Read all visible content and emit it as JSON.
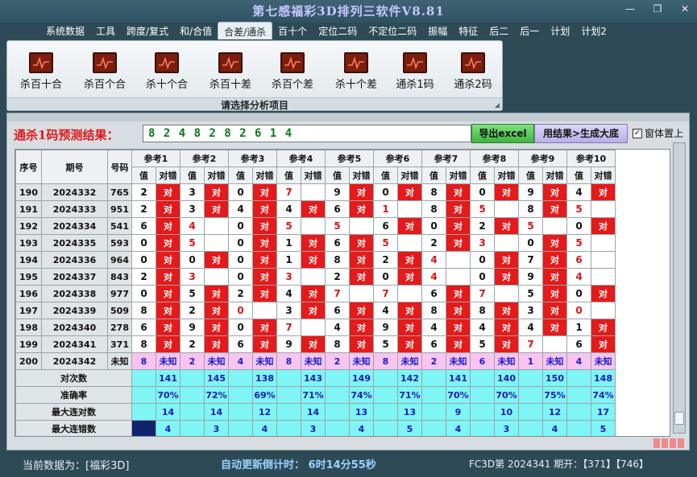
{
  "window": {
    "title": "第七感福彩3D排列三软件V8.81",
    "minimize_glyph": "—",
    "restore_glyph": "❐",
    "close_glyph": "✕"
  },
  "menu": [
    {
      "label": "系统数据",
      "active": false
    },
    {
      "label": "工具",
      "active": false
    },
    {
      "label": "跨度/复式",
      "active": false
    },
    {
      "label": "和/合值",
      "active": false
    },
    {
      "label": "合差/通杀",
      "active": true
    },
    {
      "label": "百十个",
      "active": false
    },
    {
      "label": "定位二码",
      "active": false
    },
    {
      "label": "不定位二码",
      "active": false
    },
    {
      "label": "振幅",
      "active": false
    },
    {
      "label": "特征",
      "active": false
    },
    {
      "label": "后二",
      "active": false
    },
    {
      "label": "后一",
      "active": false
    },
    {
      "label": "计划",
      "active": false
    },
    {
      "label": "计划2",
      "active": false
    }
  ],
  "ribbon": {
    "tools": [
      "杀百十合",
      "杀百个合",
      "杀十个合",
      "杀百十差",
      "杀百个差",
      "杀十个差",
      "通杀1码",
      "通杀2码"
    ],
    "caption": "请选择分析项目",
    "icon": "chart-icon"
  },
  "panel": {
    "result_label": "通杀1码预测结果：",
    "result_value": "8 2 4 8 2 8 2 6 1 4",
    "export_button": "导出excel",
    "generate_button": "用结果>生成大底",
    "on_top_label": "窗体置上",
    "on_top_checked": true
  },
  "table": {
    "headers": {
      "seq": "序号",
      "period": "期号",
      "number": "号码",
      "value": "值",
      "result": "对错"
    },
    "refs": [
      "参考1",
      "参考2",
      "参考3",
      "参考4",
      "参考5",
      "参考6",
      "参考7",
      "参考8",
      "参考9",
      "参考10"
    ],
    "hit_text": "对",
    "rows": [
      {
        "seq": "190",
        "period": "2024332",
        "number": "765",
        "cells": [
          [
            "2",
            "对",
            false
          ],
          [
            "3",
            "对",
            false
          ],
          [
            "0",
            "对",
            false
          ],
          [
            "7",
            "",
            true
          ],
          [
            "9",
            "对",
            false
          ],
          [
            "0",
            "对",
            false
          ],
          [
            "8",
            "对",
            false
          ],
          [
            "0",
            "对",
            false
          ],
          [
            "9",
            "对",
            false
          ],
          [
            "4",
            "对",
            false
          ]
        ]
      },
      {
        "seq": "191",
        "period": "2024333",
        "number": "951",
        "cells": [
          [
            "2",
            "对",
            false
          ],
          [
            "3",
            "对",
            false
          ],
          [
            "4",
            "对",
            false
          ],
          [
            "4",
            "对",
            false
          ],
          [
            "6",
            "对",
            false
          ],
          [
            "1",
            "",
            true
          ],
          [
            "8",
            "对",
            false
          ],
          [
            "5",
            "",
            true
          ],
          [
            "8",
            "对",
            false
          ],
          [
            "5",
            "",
            true
          ]
        ]
      },
      {
        "seq": "192",
        "period": "2024334",
        "number": "541",
        "cells": [
          [
            "6",
            "对",
            false
          ],
          [
            "4",
            "",
            true
          ],
          [
            "0",
            "对",
            false
          ],
          [
            "5",
            "",
            true
          ],
          [
            "5",
            "",
            true
          ],
          [
            "6",
            "对",
            false
          ],
          [
            "0",
            "对",
            false
          ],
          [
            "2",
            "对",
            false
          ],
          [
            "5",
            "",
            true
          ],
          [
            "0",
            "对",
            false
          ]
        ]
      },
      {
        "seq": "193",
        "period": "2024335",
        "number": "593",
        "cells": [
          [
            "0",
            "对",
            false
          ],
          [
            "5",
            "",
            true
          ],
          [
            "0",
            "对",
            false
          ],
          [
            "1",
            "对",
            false
          ],
          [
            "6",
            "对",
            false
          ],
          [
            "5",
            "",
            true
          ],
          [
            "2",
            "对",
            false
          ],
          [
            "3",
            "",
            true
          ],
          [
            "0",
            "对",
            false
          ],
          [
            "5",
            "",
            true
          ]
        ]
      },
      {
        "seq": "194",
        "period": "2024336",
        "number": "964",
        "cells": [
          [
            "0",
            "对",
            false
          ],
          [
            "0",
            "对",
            false
          ],
          [
            "0",
            "对",
            false
          ],
          [
            "1",
            "对",
            false
          ],
          [
            "8",
            "对",
            false
          ],
          [
            "2",
            "对",
            false
          ],
          [
            "4",
            "",
            true
          ],
          [
            "0",
            "对",
            false
          ],
          [
            "7",
            "对",
            false
          ],
          [
            "6",
            "",
            true
          ]
        ]
      },
      {
        "seq": "195",
        "period": "2024337",
        "number": "843",
        "cells": [
          [
            "2",
            "对",
            false
          ],
          [
            "3",
            "",
            true
          ],
          [
            "0",
            "对",
            false
          ],
          [
            "3",
            "",
            true
          ],
          [
            "2",
            "对",
            false
          ],
          [
            "0",
            "对",
            false
          ],
          [
            "4",
            "",
            true
          ],
          [
            "0",
            "对",
            false
          ],
          [
            "9",
            "对",
            false
          ],
          [
            "4",
            "",
            true
          ]
        ]
      },
      {
        "seq": "196",
        "period": "2024338",
        "number": "977",
        "cells": [
          [
            "0",
            "对",
            false
          ],
          [
            "5",
            "对",
            false
          ],
          [
            "2",
            "对",
            false
          ],
          [
            "4",
            "对",
            false
          ],
          [
            "7",
            "",
            true
          ],
          [
            "7",
            "",
            true
          ],
          [
            "6",
            "对",
            false
          ],
          [
            "7",
            "",
            true
          ],
          [
            "5",
            "对",
            false
          ],
          [
            "0",
            "对",
            false
          ]
        ]
      },
      {
        "seq": "197",
        "period": "2024339",
        "number": "509",
        "cells": [
          [
            "8",
            "对",
            false
          ],
          [
            "2",
            "对",
            false
          ],
          [
            "0",
            "",
            true
          ],
          [
            "3",
            "对",
            false
          ],
          [
            "6",
            "对",
            false
          ],
          [
            "4",
            "对",
            false
          ],
          [
            "8",
            "对",
            false
          ],
          [
            "8",
            "对",
            false
          ],
          [
            "3",
            "对",
            false
          ],
          [
            "0",
            "",
            true
          ]
        ]
      },
      {
        "seq": "198",
        "period": "2024340",
        "number": "278",
        "cells": [
          [
            "6",
            "对",
            false
          ],
          [
            "9",
            "对",
            false
          ],
          [
            "0",
            "对",
            false
          ],
          [
            "7",
            "",
            true
          ],
          [
            "4",
            "对",
            false
          ],
          [
            "9",
            "对",
            false
          ],
          [
            "4",
            "对",
            false
          ],
          [
            "4",
            "对",
            false
          ],
          [
            "4",
            "对",
            false
          ],
          [
            "1",
            "对",
            false
          ]
        ]
      },
      {
        "seq": "199",
        "period": "2024341",
        "number": "371",
        "cells": [
          [
            "8",
            "对",
            false
          ],
          [
            "2",
            "对",
            false
          ],
          [
            "6",
            "对",
            false
          ],
          [
            "9",
            "对",
            false
          ],
          [
            "8",
            "对",
            false
          ],
          [
            "5",
            "对",
            false
          ],
          [
            "6",
            "对",
            false
          ],
          [
            "5",
            "对",
            false
          ],
          [
            "7",
            "",
            true
          ],
          [
            "6",
            "对",
            false
          ]
        ]
      }
    ],
    "unknown_row": {
      "seq": "200",
      "period": "2024342",
      "number": "未知",
      "values": [
        "8",
        "2",
        "4",
        "8",
        "2",
        "8",
        "2",
        "6",
        "1",
        "4"
      ],
      "result": "未知"
    },
    "stats": [
      {
        "label": "对次数",
        "values": [
          "141",
          "145",
          "138",
          "143",
          "149",
          "142",
          "141",
          "140",
          "150",
          "148"
        ]
      },
      {
        "label": "准确率",
        "values": [
          "70%",
          "72%",
          "69%",
          "71%",
          "74%",
          "71%",
          "70%",
          "70%",
          "75%",
          "74%"
        ]
      },
      {
        "label": "最大连对数",
        "values": [
          "14",
          "14",
          "12",
          "14",
          "13",
          "13",
          "9",
          "10",
          "12",
          "17"
        ]
      },
      {
        "label": "最大连错数",
        "values": [
          "4",
          "3",
          "4",
          "3",
          "4",
          "5",
          "4",
          "3",
          "4",
          "5"
        ]
      }
    ]
  },
  "status": {
    "current_data": "当前数据为：[福彩3D]",
    "countdown": "自动更新倒计时： 6时14分55秒",
    "draw_info": "FC3D第 2024341 期开：【371】【746】"
  }
}
